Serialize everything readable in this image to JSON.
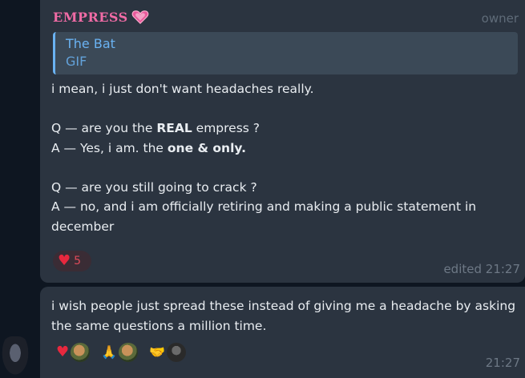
{
  "message1": {
    "sender": "EMPRESS",
    "role": "owner",
    "reply": {
      "title": "The Bat",
      "type": "GIF"
    },
    "lines": [
      "i mean, i just don't want headaches really.",
      "",
      "Q — are you the REAL empress ?",
      "A — Yes, i am. the one & only.",
      "",
      "Q — are you still going to crack ?",
      "A — no, and i am officially retiring and making a public statement in december"
    ],
    "bold_fragments": [
      "REAL",
      "one & only."
    ],
    "reaction": {
      "icon": "heart-icon",
      "count": "5"
    },
    "edited_label": "edited 21:27"
  },
  "message2": {
    "text": "i wish people just spread these instead of giving me a headache by asking the same questions a million time.",
    "reactions": [
      {
        "icon": "heart-icon"
      },
      {
        "icon": "folded-hands-icon"
      },
      {
        "icon": "handshake-icon"
      }
    ],
    "time": "21:27"
  },
  "colors": {
    "background": "#0e1621",
    "bubble": "#2b3440",
    "sender": "#f06ba5",
    "reply_accent": "#6ab2f2",
    "heart": "#e8283e"
  }
}
